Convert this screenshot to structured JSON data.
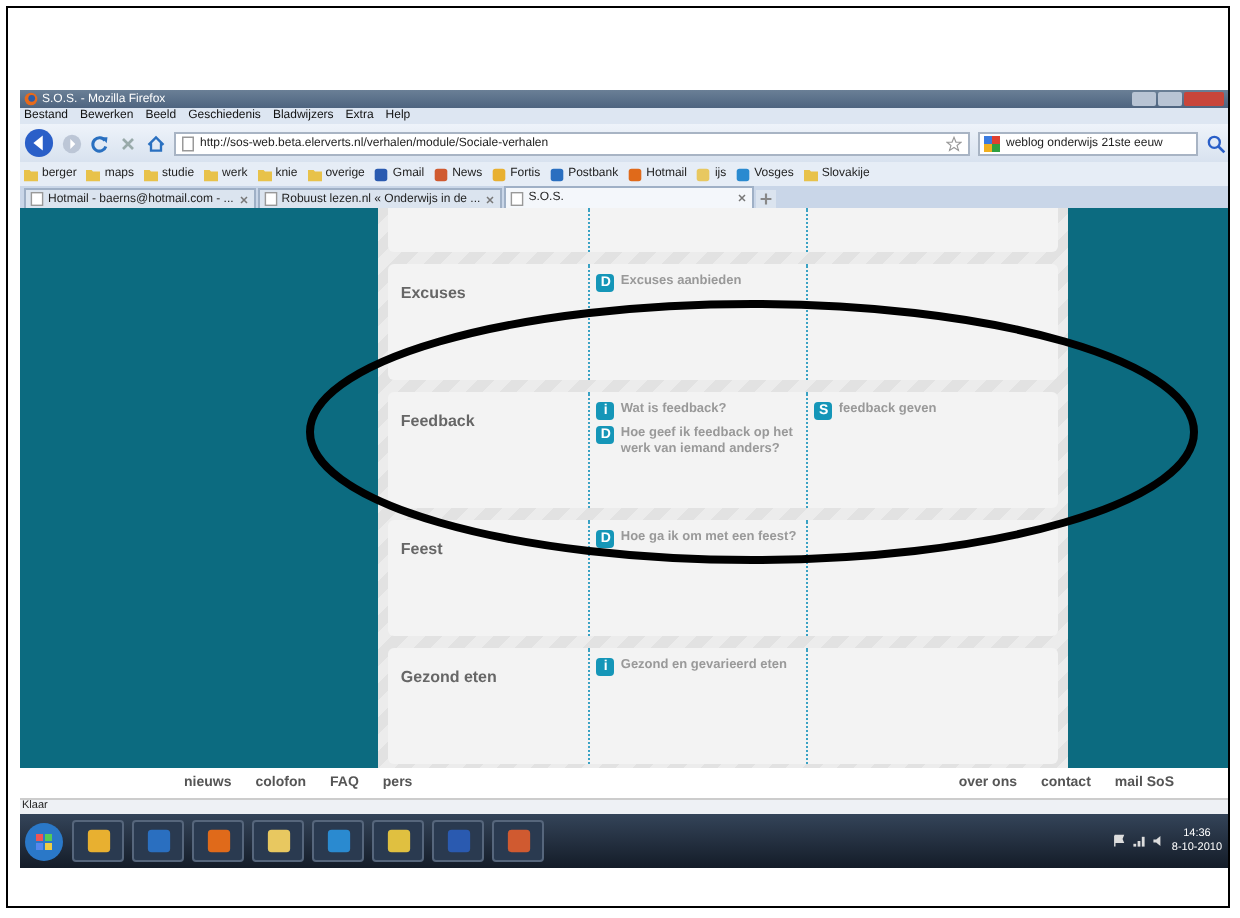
{
  "window": {
    "title": "S.O.S. - Mozilla Firefox"
  },
  "menu": [
    "Bestand",
    "Bewerken",
    "Beeld",
    "Geschiedenis",
    "Bladwijzers",
    "Extra",
    "Help"
  ],
  "address": {
    "value": "http://sos-web.beta.elerverts.nl/verhalen/module/Sociale-verhalen"
  },
  "search": {
    "value": "weblog onderwijs 21ste eeuw"
  },
  "bookmarks": [
    {
      "label": "berger",
      "kind": "folder"
    },
    {
      "label": "maps",
      "kind": "folder"
    },
    {
      "label": "studie",
      "kind": "folder"
    },
    {
      "label": "werk",
      "kind": "folder"
    },
    {
      "label": "knie",
      "kind": "folder"
    },
    {
      "label": "overige",
      "kind": "folder"
    },
    {
      "label": "Gmail",
      "kind": "site"
    },
    {
      "label": "News",
      "kind": "site"
    },
    {
      "label": "Fortis",
      "kind": "site"
    },
    {
      "label": "Postbank",
      "kind": "site"
    },
    {
      "label": "Hotmail",
      "kind": "site"
    },
    {
      "label": "ijs",
      "kind": "site"
    },
    {
      "label": "Vosges",
      "kind": "site"
    },
    {
      "label": "Slovakije",
      "kind": "folder"
    }
  ],
  "tabs": [
    {
      "label": "Hotmail - baerns@hotmail.com - ...",
      "selected": false
    },
    {
      "label": "Robuust lezen.nl « Onderwijs in de ...",
      "selected": false
    },
    {
      "label": "S.O.S.",
      "selected": true
    }
  ],
  "sections": [
    {
      "title": "Excuses",
      "col_2": [
        {
          "badge": "D",
          "text": "Excuses aanbieden"
        }
      ]
    },
    {
      "title": "Feedback",
      "col_2": [
        {
          "badge": "i",
          "text": "Wat is feedback?"
        },
        {
          "badge": "D",
          "text": "Hoe geef ik feedback op het werk van iemand anders?"
        }
      ],
      "col_3": [
        {
          "badge": "S",
          "text": "feedback geven"
        }
      ]
    },
    {
      "title": "Feest",
      "col_2": [
        {
          "badge": "D",
          "text": "Hoe ga ik om met een feest?"
        }
      ]
    },
    {
      "title": "Gezond eten",
      "col_2": [
        {
          "badge": "i",
          "text": "Gezond en gevarieerd eten"
        }
      ]
    }
  ],
  "footer": {
    "left": [
      "nieuws",
      "colofon",
      "FAQ",
      "pers"
    ],
    "right": [
      "over ons",
      "contact",
      "mail SoS"
    ]
  },
  "status_bar": "Klaar",
  "taskbar": {
    "time": "14:36",
    "date": "8-10-2010"
  }
}
